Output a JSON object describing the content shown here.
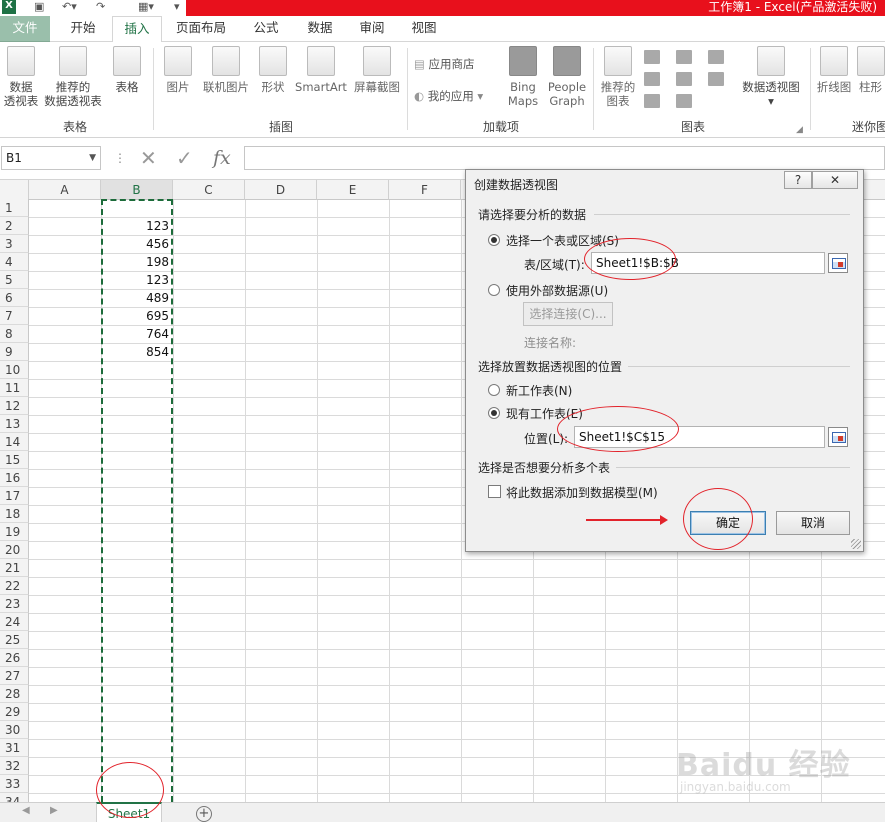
{
  "app": {
    "title": "工作簿1 -  Excel(产品激活失败)"
  },
  "tabs": [
    {
      "label": "文件",
      "active": false
    },
    {
      "label": "开始",
      "active": false
    },
    {
      "label": "插入",
      "active": true
    },
    {
      "label": "页面布局",
      "active": false
    },
    {
      "label": "公式",
      "active": false
    },
    {
      "label": "数据",
      "active": false
    },
    {
      "label": "审阅",
      "active": false
    },
    {
      "label": "视图",
      "active": false
    }
  ],
  "ribbon": {
    "groups": {
      "tables": "表格",
      "illustrations": "插图",
      "addins": "加载项",
      "charts": "图表",
      "sparklines": "迷你图"
    },
    "buttons": {
      "pivot_line1": "数据",
      "pivot_line2": "透视表",
      "rec_pivot_line1": "推荐的",
      "rec_pivot_line2": "数据透视表",
      "table": "表格",
      "pictures": "图片",
      "online_pictures": "联机图片",
      "shapes": "形状",
      "smartart": "SmartArt",
      "screenshot": "屏幕截图",
      "app_store": "应用商店",
      "my_apps": "我的应用",
      "bing_maps_line1": "Bing",
      "bing_maps_line2": "Maps",
      "people_graph_line1": "People",
      "people_graph_line2": "Graph",
      "rec_charts_line1": "推荐的",
      "rec_charts_line2": "图表",
      "pivot_chart": "数据透视图",
      "line": "折线图",
      "column": "柱形"
    }
  },
  "formula_bar": {
    "name_box": "B1",
    "fx": "fx",
    "cancel": "✕",
    "enter": "✓"
  },
  "grid": {
    "columns": [
      "A",
      "B",
      "C",
      "D",
      "E",
      "F"
    ],
    "rows": [
      "1",
      "2",
      "3",
      "4",
      "5",
      "6",
      "7",
      "8",
      "9",
      "10",
      "11",
      "12",
      "13",
      "14",
      "15",
      "16",
      "17",
      "18",
      "19",
      "20",
      "21",
      "22",
      "23",
      "24",
      "25",
      "26",
      "27",
      "28",
      "29",
      "30",
      "31",
      "32",
      "33",
      "34"
    ],
    "column_b_values": [
      "123",
      "456",
      "198",
      "123",
      "489",
      "695",
      "764",
      "854"
    ]
  },
  "sheet_tabs": {
    "active": "Sheet1",
    "add": "+"
  },
  "dialog": {
    "title": "创建数据透视图",
    "help": "?",
    "close": "✕",
    "section1": "请选择要分析的数据",
    "opt_table_range": "选择一个表或区域(S)",
    "table_range_label": "表/区域(T):",
    "table_range_value": "Sheet1!$B:$B",
    "opt_external": "使用外部数据源(U)",
    "choose_conn": "选择连接(C)...",
    "conn_name": "连接名称:",
    "section2": "选择放置数据透视图的位置",
    "opt_new_ws": "新工作表(N)",
    "opt_existing_ws": "现有工作表(E)",
    "location_label": "位置(L):",
    "location_value": "Sheet1!$C$15",
    "section3": "选择是否想要分析多个表",
    "add_to_model": "将此数据添加到数据模型(M)",
    "ok": "确定",
    "cancel": "取消"
  },
  "watermark": {
    "brand": "Baidu 经验",
    "url": "jingyan.baidu.com"
  },
  "colors": {
    "title_red": "#e8101c",
    "excel_green": "#217346",
    "annotation_red": "#e2232b"
  }
}
